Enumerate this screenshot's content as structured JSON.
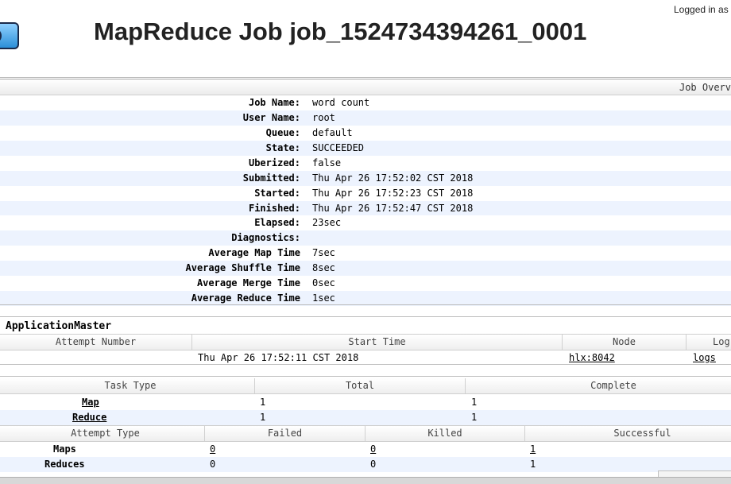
{
  "header": {
    "title": "MapReduce Job job_1524734394261_0001",
    "login": "Logged in as"
  },
  "overview": {
    "bar_label": "Job Overv",
    "rows": [
      {
        "label": "Job Name:",
        "value": "word count"
      },
      {
        "label": "User Name:",
        "value": "root"
      },
      {
        "label": "Queue:",
        "value": "default"
      },
      {
        "label": "State:",
        "value": "SUCCEEDED"
      },
      {
        "label": "Uberized:",
        "value": "false"
      },
      {
        "label": "Submitted:",
        "value": "Thu Apr 26 17:52:02 CST 2018"
      },
      {
        "label": "Started:",
        "value": "Thu Apr 26 17:52:23 CST 2018"
      },
      {
        "label": "Finished:",
        "value": "Thu Apr 26 17:52:47 CST 2018"
      },
      {
        "label": "Elapsed:",
        "value": "23sec"
      },
      {
        "label": "Diagnostics:",
        "value": ""
      },
      {
        "label": "Average Map Time",
        "value": "7sec"
      },
      {
        "label": "Average Shuffle Time",
        "value": "8sec"
      },
      {
        "label": "Average Merge Time",
        "value": "0sec"
      },
      {
        "label": "Average Reduce Time",
        "value": "1sec"
      }
    ]
  },
  "application_master": {
    "heading": "ApplicationMaster",
    "columns": [
      "Attempt Number",
      "Start Time",
      "Node",
      "Log"
    ],
    "row": {
      "attempt": "",
      "start_time": "Thu Apr 26 17:52:11 CST 2018",
      "node": "hlx:8042",
      "logs": "logs"
    }
  },
  "tasks": {
    "columns": [
      "Task Type",
      "Total",
      "Complete"
    ],
    "rows": [
      {
        "type": "Map",
        "total": "1",
        "complete": "1"
      },
      {
        "type": "Reduce",
        "total": "1",
        "complete": "1"
      }
    ]
  },
  "attempts": {
    "columns": [
      "Attempt Type",
      "Failed",
      "Killed",
      "Successful"
    ],
    "rows": [
      {
        "type": "Maps",
        "failed": "0",
        "killed": "0",
        "successful": "1"
      },
      {
        "type": "Reduces",
        "failed": "0",
        "killed": "0",
        "successful": "1"
      }
    ]
  }
}
